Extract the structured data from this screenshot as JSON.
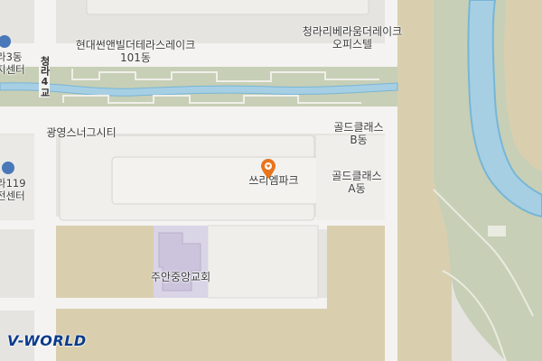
{
  "map": {
    "labels": {
      "building_101": "현대썬앤빌더테라스레이크\n101동",
      "office_tel": "청라리베라움더레이크\n오피스텔",
      "gwangyoung": "광영스너그시티",
      "gold_b": "골드클래스\nB동",
      "gold_a": "골드클래스\nA동",
      "three_park": "쓰리엠파크",
      "church": "주안중앙교회",
      "dong_partial": "라3동\n지센터",
      "fire_partial": "라119\n전센터",
      "bridge_sign": "청라4교"
    },
    "colors": {
      "land": "#e6e4e0",
      "block": "#efeeeb",
      "road": "#f7f6f4",
      "greenery": "#c7cfb6",
      "water": "#a7cfe4",
      "water_edge": "#77b6d6",
      "tan": "#d9cfae",
      "lavender": "#d9d4e6",
      "pin": "#e8741c"
    },
    "marker": {
      "name": "location-pin-icon"
    }
  },
  "branding": {
    "logo": "V-WORLD"
  }
}
